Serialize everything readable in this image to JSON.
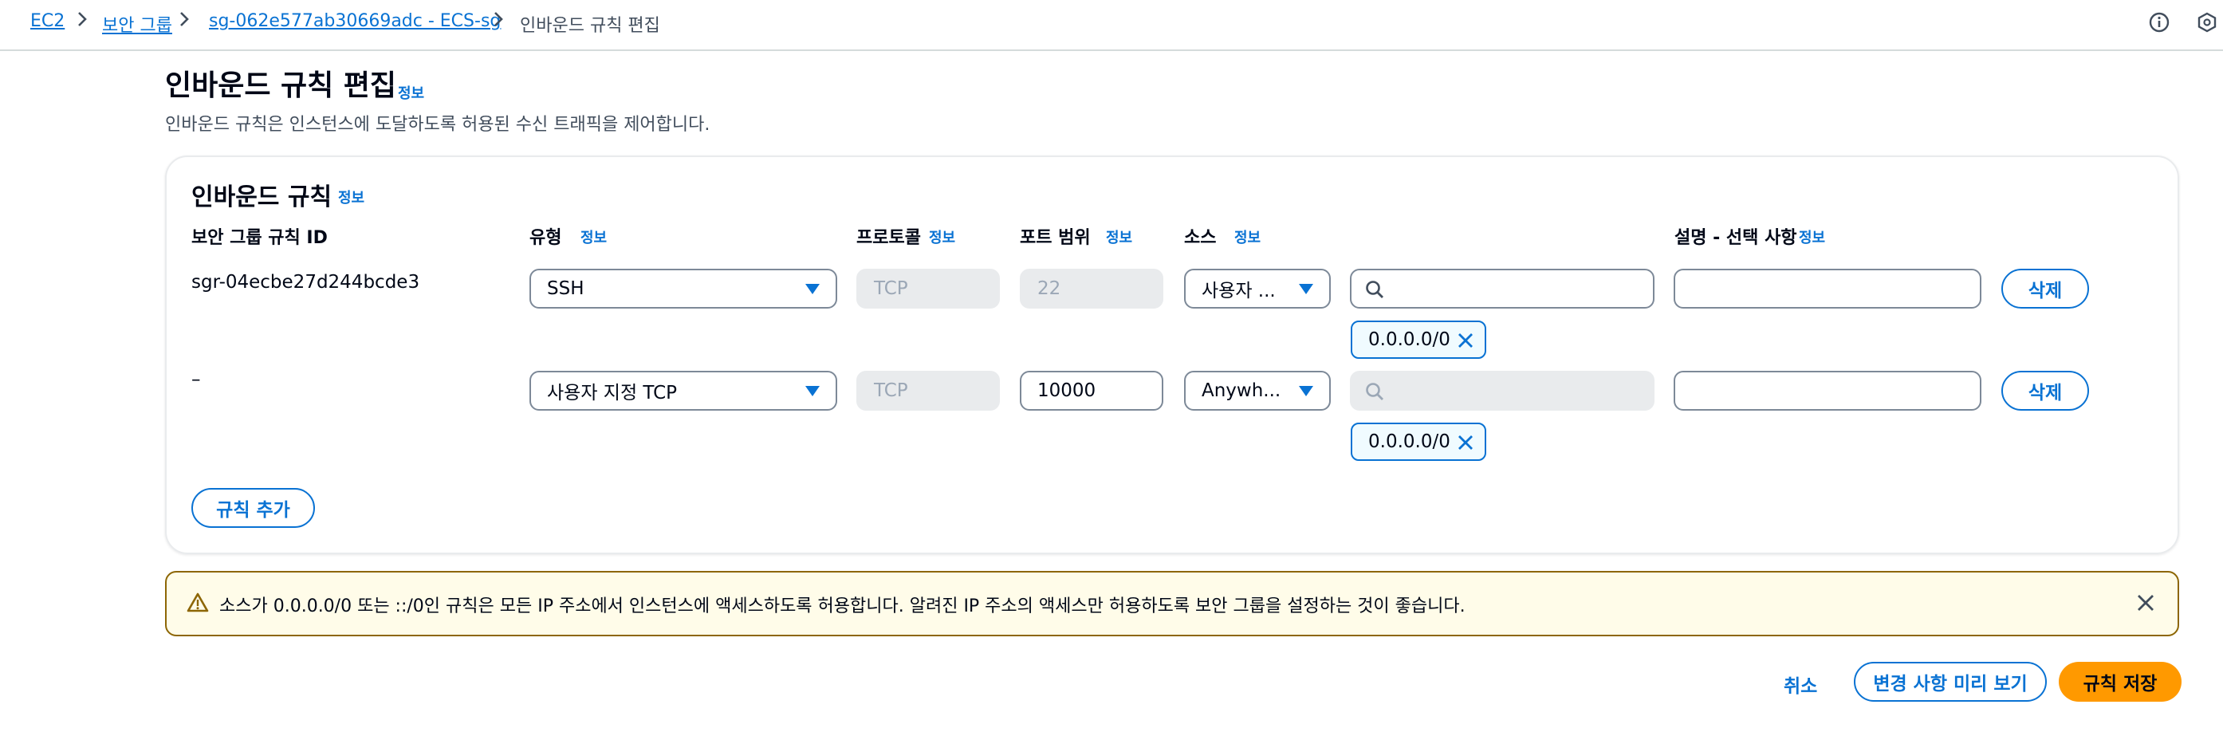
{
  "breadcrumb": {
    "items": [
      "EC2",
      "보안 그룹",
      "sg-062e577ab30669adc - ECS-sg"
    ],
    "current": "인바운드 규칙 편집"
  },
  "page": {
    "title": "인바운드 규칙 편집",
    "info": "정보",
    "description": "인바운드 규칙은 인스턴스에 도달하도록 허용된 수신 트래픽을 제어합니다."
  },
  "panel": {
    "title": "인바운드 규칙",
    "info": "정보",
    "columns": {
      "rule_id": "보안 그룹 규칙 ID",
      "type": "유형",
      "type_info": "정보",
      "protocol": "프로토콜",
      "protocol_info": "정보",
      "port": "포트 범위",
      "port_info": "정보",
      "source": "소스",
      "source_info": "정보",
      "description": "설명 - 선택 사항",
      "description_info": "정보"
    },
    "rules": [
      {
        "id": "sgr-04ecbe27d244bcde3",
        "type": "SSH",
        "protocol": "TCP",
        "port": "22",
        "source_type": "사용자 ...",
        "source_search": "",
        "cidr": "0.0.0.0/0",
        "description": "",
        "delete_label": "삭제"
      },
      {
        "id": "–",
        "type": "사용자 지정 TCP",
        "protocol": "TCP",
        "port": "10000",
        "source_type": "Anywh...",
        "source_search": "",
        "cidr": "0.0.0.0/0",
        "description": "",
        "delete_label": "삭제"
      }
    ],
    "add_rule_label": "규칙 추가"
  },
  "alert": {
    "text": "소스가 0.0.0.0/0 또는 ::/0인 규칙은 모든 IP 주소에서 인스턴스에 액세스하도록 허용합니다. 알려진 IP 주소의 액세스만 허용하도록 보안 그룹을 설정하는 것이 좋습니다."
  },
  "footer": {
    "cancel_label": "취소",
    "preview_label": "변경 사항 미리 보기",
    "save_label": "규칙 저장"
  },
  "colors": {
    "link": "#0972d3",
    "primary_button": "#ff9900",
    "warning_bg": "#fffce9",
    "warning_border": "#8d6605",
    "disabled_bg": "#e9ebed"
  },
  "icons": [
    "chevron-right-icon",
    "info-circle-icon",
    "hexagon-icon",
    "caret-down-icon",
    "search-icon",
    "close-icon",
    "warning-icon"
  ]
}
